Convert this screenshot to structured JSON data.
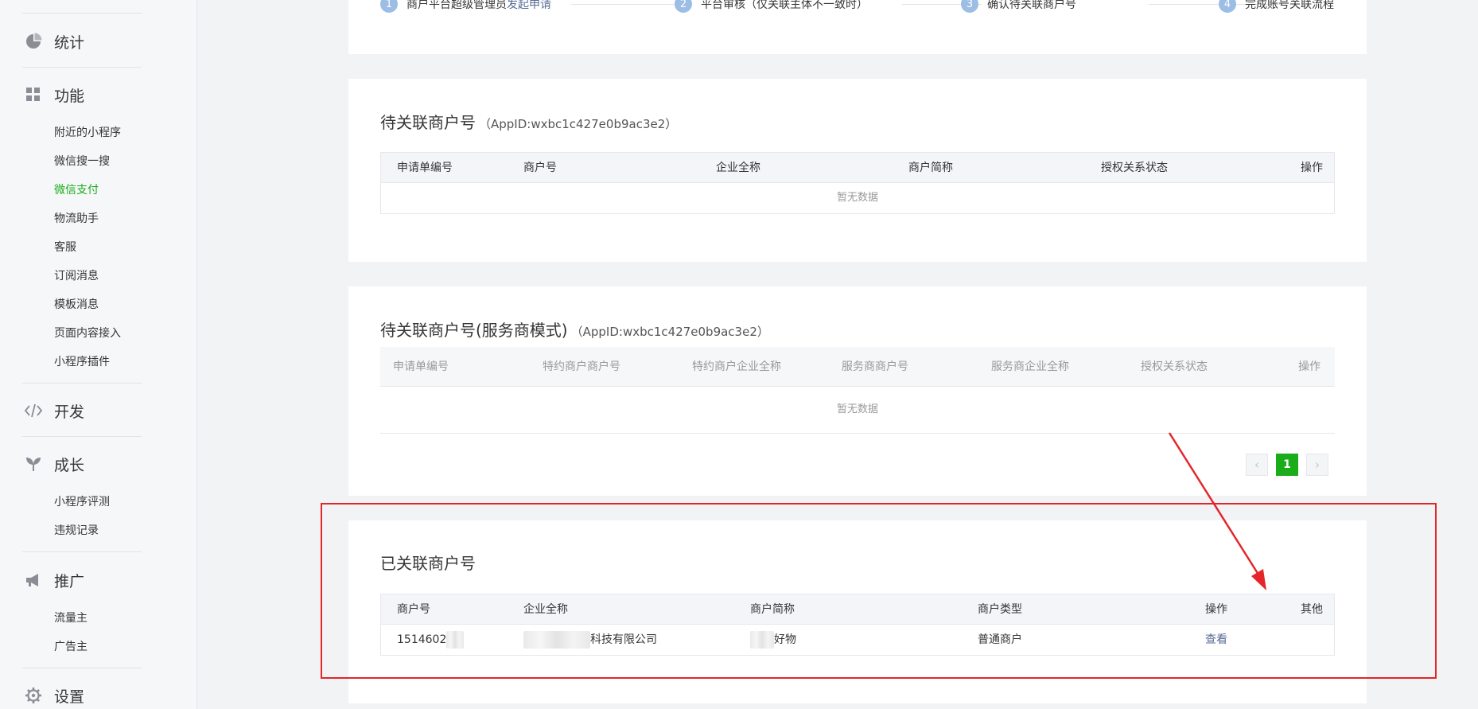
{
  "sidebar": {
    "groups": [
      {
        "label": "统计",
        "icon": "pie-chart-icon",
        "items": []
      },
      {
        "label": "功能",
        "icon": "grid-icon",
        "items": [
          "附近的小程序",
          "微信搜一搜",
          "微信支付",
          "物流助手",
          "客服",
          "订阅消息",
          "模板消息",
          "页面内容接入",
          "小程序插件"
        ]
      },
      {
        "label": "开发",
        "icon": "code-icon",
        "items": []
      },
      {
        "label": "成长",
        "icon": "sprout-icon",
        "items": [
          "小程序评测",
          "违规记录"
        ]
      },
      {
        "label": "推广",
        "icon": "megaphone-icon",
        "items": [
          "流量主",
          "广告主"
        ]
      },
      {
        "label": "设置",
        "icon": "gear-icon",
        "items": []
      }
    ],
    "active_item": "微信支付"
  },
  "steps": [
    {
      "num": "1",
      "label": "商户平台超级管理员",
      "link": "发起申请"
    },
    {
      "num": "2",
      "label": "平台审核（仅关联主体不一致时）",
      "link": ""
    },
    {
      "num": "3",
      "label": "确认待关联商户号",
      "link": ""
    },
    {
      "num": "4",
      "label": "完成账号关联流程",
      "link": ""
    }
  ],
  "pending": {
    "title": "待关联商户号",
    "appid": "（AppID:wxbc1c427e0b9ac3e2）",
    "columns": [
      "申请单编号",
      "商户号",
      "企业全称",
      "商户简称",
      "授权关系状态",
      "操作"
    ],
    "empty": "暂无数据"
  },
  "pending_service": {
    "title": "待关联商户号(服务商模式)",
    "appid": "（AppID:wxbc1c427e0b9ac3e2）",
    "columns": [
      "申请单编号",
      "特约商户商户号",
      "特约商户企业全称",
      "服务商商户号",
      "服务商企业全称",
      "授权关系状态",
      "操作"
    ],
    "empty": "暂无数据",
    "pagination": {
      "prev": "‹",
      "current": "1",
      "next": "›"
    }
  },
  "linked": {
    "title": "已关联商户号",
    "columns": [
      "商户号",
      "企业全称",
      "商户简称",
      "商户类型",
      "操作",
      "其他"
    ],
    "rows": [
      {
        "merchant_id": "1514602",
        "company_suffix": "科技有限公司",
        "short_name_suffix": "好物",
        "type": "普通商户",
        "action": "查看"
      }
    ]
  },
  "colors": {
    "accent": "#1aad19",
    "link": "#576b95",
    "annotation": "#e4262a"
  }
}
